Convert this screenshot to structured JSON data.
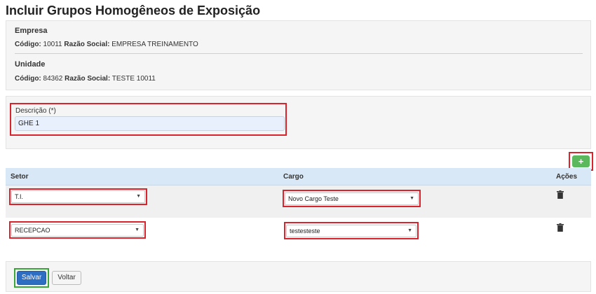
{
  "page": {
    "title": "Incluir Grupos Homogêneos de Exposição"
  },
  "empresa": {
    "section": "Empresa",
    "codigo_label": "Código:",
    "codigo_value": "10011",
    "razao_label": "Razão Social:",
    "razao_value": "EMPRESA TREINAMENTO"
  },
  "unidade": {
    "section": "Unidade",
    "codigo_label": "Código:",
    "codigo_value": "84362",
    "razao_label": "Razão Social:",
    "razao_value": "TESTE 10011"
  },
  "form": {
    "descricao_label": "Descrição (*)",
    "descricao_value": "GHE 1",
    "add_label": "+"
  },
  "table": {
    "headers": {
      "setor": "Setor",
      "cargo": "Cargo",
      "acoes": "Ações"
    },
    "rows": [
      {
        "setor": "T.I.",
        "cargo": "Novo Cargo Teste"
      },
      {
        "setor": "RECEPCAO",
        "cargo": "testesteste"
      }
    ]
  },
  "footer": {
    "save_label": "Salvar",
    "back_label": "Voltar"
  },
  "colors": {
    "highlight": "#d9232d",
    "add": "#5cb85c",
    "save": "#2e6ec2",
    "header": "#d9e8f6"
  }
}
